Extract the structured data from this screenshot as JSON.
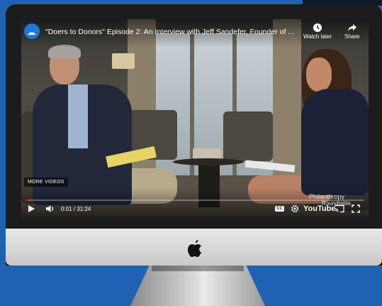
{
  "video": {
    "title": "\"Doers to Donors\" Episode 2: An Interview with Jeff Sandefer, Founder of ...",
    "watch_later_label": "Watch later",
    "share_label": "Share",
    "more_videos_label": "MORE VIDEOS",
    "time_display": "0:01 / 31:24",
    "progress_fraction": 0.0005,
    "youtube_wordmark": "YouTube",
    "watermark_line1": "Philanthropy",
    "watermark_line2": "Roundtable"
  },
  "icons": {
    "channel": "channel-logo-icon",
    "watch_later": "clock-icon",
    "share": "share-arrow-icon",
    "play": "play-icon",
    "volume": "volume-icon",
    "captions": "captions-icon",
    "settings": "gear-icon",
    "cast": "cast-icon",
    "fullscreen": "fullscreen-icon",
    "apple": "apple-logo-icon"
  },
  "colors": {
    "background": "#1f62b3",
    "progress": "#ff0000",
    "channel_logo": "#1d78d6"
  }
}
